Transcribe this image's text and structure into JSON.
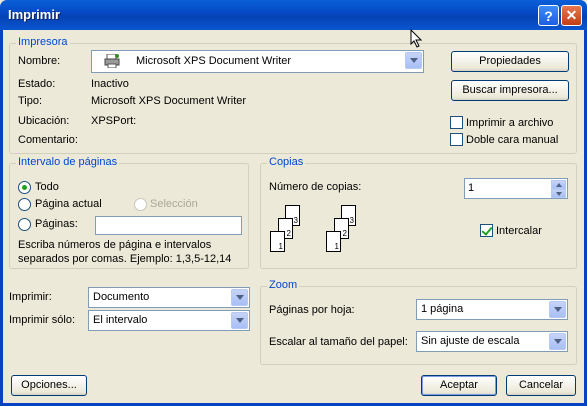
{
  "window": {
    "title": "Imprimir",
    "help_glyph": "?",
    "close_glyph": "✕"
  },
  "printer": {
    "group_title": "Impresora",
    "name_label": "Nombre:",
    "name_value": "Microsoft XPS Document Writer",
    "status_label": "Estado:",
    "status_value": "Inactivo",
    "type_label": "Tipo:",
    "type_value": "Microsoft XPS Document Writer",
    "location_label": "Ubicación:",
    "location_value": "XPSPort:",
    "comment_label": "Comentario:",
    "properties_button": "Propiedades",
    "find_printer_button": "Buscar impresora...",
    "print_to_file": {
      "label": "Imprimir a archivo",
      "checked": false
    },
    "manual_duplex": {
      "label": "Doble cara manual",
      "checked": false
    }
  },
  "page_range": {
    "group_title": "Intervalo de páginas",
    "all": "Todo",
    "current": "Página actual",
    "selection": "Selección",
    "pages": "Páginas:",
    "pages_value": "",
    "selected": "all",
    "hint_line1": "Escriba números de página e intervalos",
    "hint_line2": "separados por comas. Ejemplo: 1,3,5-12,14"
  },
  "copies": {
    "group_title": "Copias",
    "count_label": "Número de copias:",
    "count_value": "1",
    "collate_label": "Intercalar",
    "collate_checked": true,
    "page_numbers": [
      "1",
      "2",
      "3"
    ]
  },
  "print_what": {
    "label": "Imprimir:",
    "value": "Documento",
    "only_label": "Imprimir sólo:",
    "only_value": "El intervalo"
  },
  "zoom": {
    "group_title": "Zoom",
    "pages_per_sheet_label": "Páginas por hoja:",
    "pages_per_sheet_value": "1 página",
    "scale_label": "Escalar al tamaño del papel:",
    "scale_value": "Sin ajuste de escala"
  },
  "footer": {
    "options_button": "Opciones...",
    "ok_button": "Aceptar",
    "cancel_button": "Cancelar"
  },
  "colors": {
    "title_bar": "#0548c2",
    "group_title": "#0046d5",
    "dialog_bg": "#ece9d8"
  }
}
